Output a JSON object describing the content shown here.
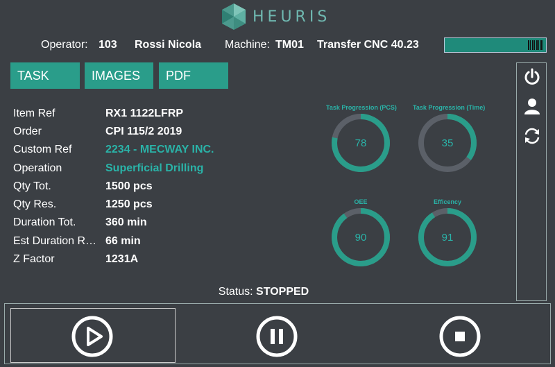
{
  "app": {
    "brand": "HEURIS"
  },
  "header": {
    "operator_label": "Operator:",
    "operator_id": "103",
    "operator_name": "Rossi Nicola",
    "machine_label": "Machine:",
    "machine_id": "TM01",
    "machine_name": "Transfer CNC 40.23"
  },
  "tabs": [
    {
      "label": "TASK"
    },
    {
      "label": "IMAGES"
    },
    {
      "label": "PDF"
    }
  ],
  "task": {
    "rows": [
      {
        "label": "Item Ref",
        "value": "RX1  1122LFRP"
      },
      {
        "label": "Order",
        "value": "CPI 115/2 2019"
      },
      {
        "label": "Custom Ref",
        "value": "2234  -  MECWAY INC."
      },
      {
        "label": "Operation",
        "value": "Superficial Drilling"
      },
      {
        "label": "Qty Tot.",
        "value": "1500 pcs"
      },
      {
        "label": "Qty Res.",
        "value": "1250 pcs"
      },
      {
        "label": "Duration Tot.",
        "value": "360 min"
      },
      {
        "label": "Est Duration Res.",
        "value": "66 min"
      },
      {
        "label": "Z Factor",
        "value": "1231A"
      }
    ]
  },
  "gauges": [
    {
      "title": "Task Progression (PCS)",
      "value": "78"
    },
    {
      "title": "Task Progression (Time)",
      "value": "35"
    },
    {
      "title": "OEE",
      "value": "90"
    },
    {
      "title": "Efficency",
      "value": "91"
    }
  ],
  "status": {
    "label": "Status:",
    "value": "STOPPED"
  },
  "colors": {
    "accent": "#2a9d8a",
    "track": "#5b6068",
    "background": "#3b3f44",
    "teal_text": "#2ab3a8"
  },
  "icons": {
    "side": [
      "power-icon",
      "user-icon",
      "refresh-icon"
    ],
    "controls": [
      "play-icon",
      "pause-icon",
      "stop-icon"
    ]
  }
}
